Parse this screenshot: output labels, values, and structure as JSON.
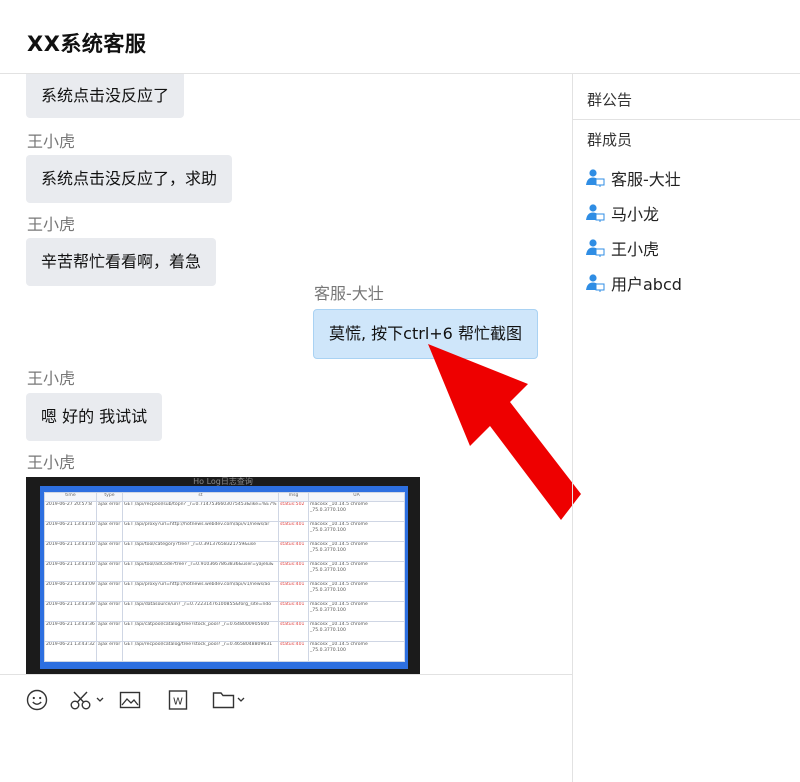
{
  "header": {
    "title": "XX系统客服"
  },
  "messages": [
    {
      "sender": "",
      "text": "系统点击没反应了",
      "mine": false
    },
    {
      "sender": "王小虎",
      "text": "系统点击没反应了，求助",
      "mine": false
    },
    {
      "sender": "王小虎",
      "text": "辛苦帮忙看看啊，着急",
      "mine": false
    },
    {
      "sender": "客服-大壮",
      "text": "莫慌, 按下ctrl+6 帮忙截图",
      "mine": true
    },
    {
      "sender": "王小虎",
      "text": "嗯 好的 我试试",
      "mine": false
    },
    {
      "sender": "王小虎",
      "image": "screenshot"
    }
  ],
  "screenshot": {
    "caption": "Ho Log日志查询",
    "columns": [
      "time",
      "type",
      "st",
      "msg",
      "UA"
    ],
    "rows": [
      [
        "2019-06-27 20:57:8",
        "ajax error",
        "GET /api/recpool/sub/topn? _r=0.7147536603075453&like=%E7%",
        "status:502",
        "macosx _10.14.5 chrome _75.0.3770.100"
      ],
      [
        "2019-06-21 13:43:10",
        "ajax error",
        "GET /api/proxy?url=http://hotnews.webdev.com/api/v1/news/ar",
        "status:401",
        "macosx _10.14.5 chrome _75.0.3770.100"
      ],
      [
        "2019-06-21 13:43:10",
        "ajax error",
        "GET /api/tool/category?tree? _r=0.39137658321759&use",
        "status:401",
        "macosx _10.14.5 chrome _75.0.3770.100"
      ],
      [
        "2019-06-21 13:43:10",
        "ajax error",
        "GET /api/tool/adCode?tree? _r=0.9103667863836&user=yajelu&",
        "status:401",
        "macosx _10.14.5 chrome _75.0.3770.100"
      ],
      [
        "2019-06-21 13:43:09",
        "ajax error",
        "GET /api/proxy?url=http://hotnews.webdev.com/api/v1/news/ao",
        "status:401",
        "macosx _10.14.5 chrome _75.0.3770.100"
      ],
      [
        "2019-06-21 13:43:39",
        "ajax error",
        "GET /api/datasource/uri? _r=0.72231476100855&forg_site=ndo",
        "status:401",
        "macosx _10.14.5 chrome _75.0.3770.100"
      ],
      [
        "2019-06-21 13:43:36",
        "ajax error",
        "GET /api/catpool/catalog/tree?stock_pool? _r=0.648000905600",
        "status:401",
        "macosx _10.14.5 chrome _75.0.3770.100"
      ],
      [
        "2019-06-21 13:43:32",
        "ajax error",
        "GET /api/recpool/catalog/tree?stock_pool? _r=0.4658048809631",
        "status:401",
        "macosx _10.14.5 chrome _75.0.3770.100"
      ]
    ]
  },
  "toolbar": {
    "icons": [
      "smiley-icon",
      "scissors-icon",
      "image-icon",
      "word-file-icon",
      "folder-icon"
    ]
  },
  "sidebar": {
    "announcement_label": "群公告",
    "members_label": "群成员",
    "members": [
      {
        "name": "客服-大壮",
        "icon": "user-icon"
      },
      {
        "name": "马小龙",
        "icon": "user-icon"
      },
      {
        "name": "王小虎",
        "icon": "user-icon"
      },
      {
        "name": "用户abcd",
        "icon": "user-icon"
      }
    ]
  },
  "colors": {
    "bubble_other": "#e9ebef",
    "bubble_mine": "#cfe6fa",
    "arrow": "#ee0000",
    "user_icon": "#2f8de4"
  }
}
